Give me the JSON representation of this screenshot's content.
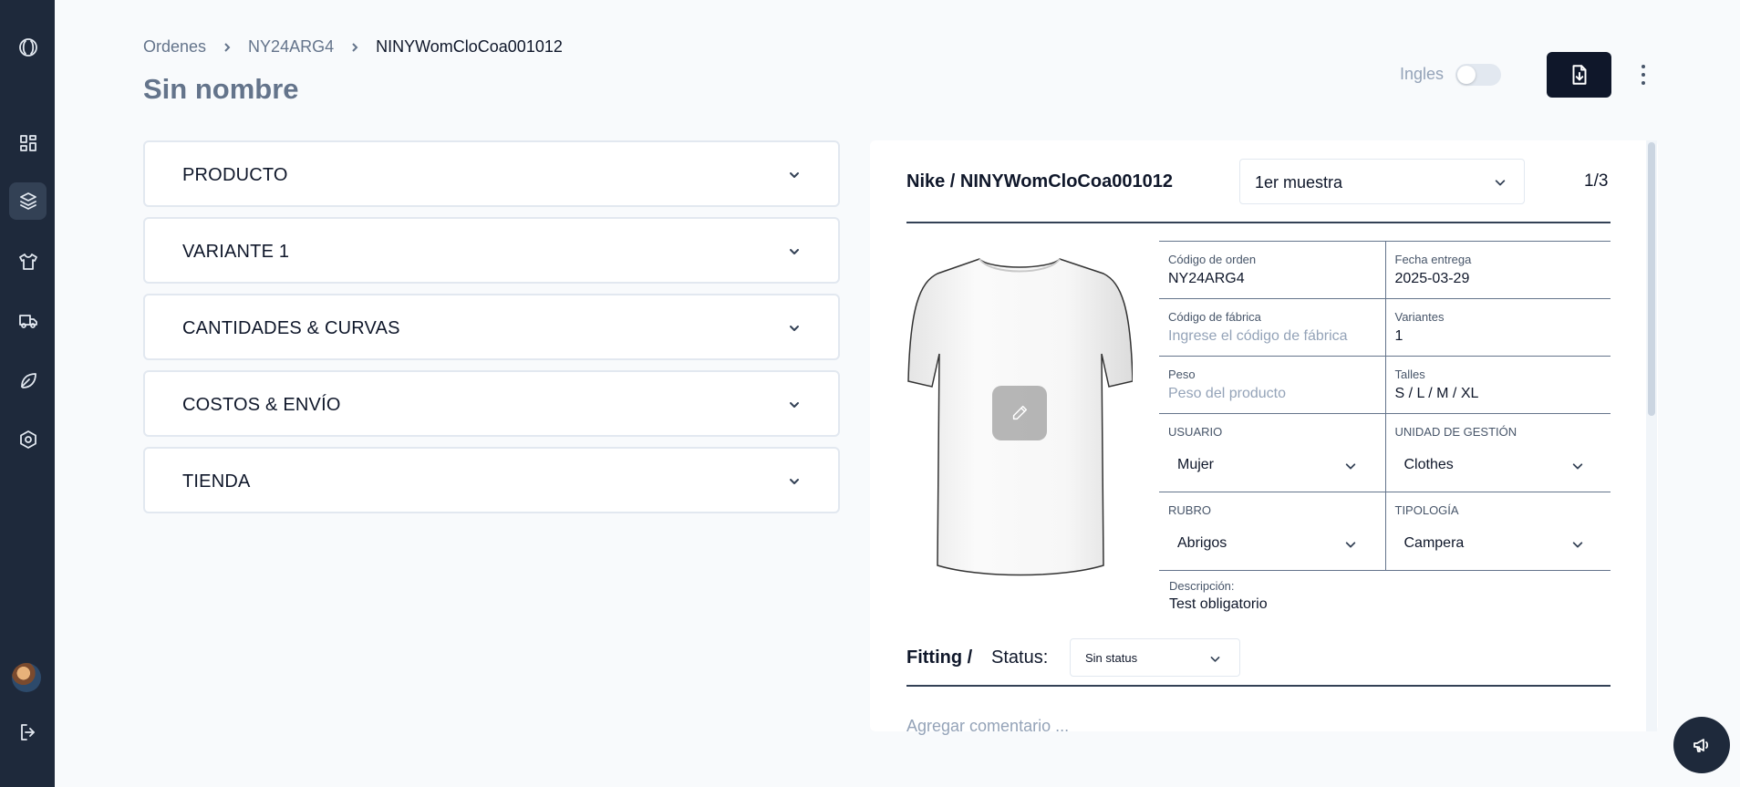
{
  "sidebar": {
    "items": [
      {
        "icon": "logo-icon"
      },
      {
        "icon": "dashboard-icon"
      },
      {
        "icon": "box-icon",
        "active": true
      },
      {
        "icon": "shirt-icon"
      },
      {
        "icon": "truck-icon"
      },
      {
        "icon": "leaf-icon"
      },
      {
        "icon": "settings-icon"
      }
    ],
    "bottom": [
      {
        "icon": "avatar"
      },
      {
        "icon": "logout-icon"
      }
    ]
  },
  "breadcrumb": [
    "Ordenes",
    "NY24ARG4",
    "NINYWomCloCoa001012"
  ],
  "page_title": "Sin nombre",
  "header": {
    "lang_label": "Ingles",
    "lang_toggle_on": false
  },
  "sections": [
    "PRODUCTO",
    "VARIANTE 1",
    "CANTIDADES & CURVAS",
    "COSTOS & ENVÍO",
    "TIENDA"
  ],
  "panel": {
    "title": "Nike / NINYWomCloCoa001012",
    "sample_select": "1er muestra",
    "pager": "1/3",
    "fields": {
      "codigo_orden": {
        "label": "Código de orden",
        "value": "NY24ARG4"
      },
      "fecha_entrega": {
        "label": "Fecha entrega",
        "value": "2025-03-29"
      },
      "codigo_fabrica": {
        "label": "Código de fábrica",
        "placeholder": "Ingrese el código de fábrica"
      },
      "variantes": {
        "label": "Variantes",
        "value": "1"
      },
      "peso": {
        "label": "Peso",
        "placeholder": "Peso del producto"
      },
      "talles": {
        "label": "Talles",
        "value": "S / L / M / XL"
      },
      "usuario": {
        "label": "USUARIO",
        "value": "Mujer"
      },
      "unidad_gestion": {
        "label": "UNIDAD DE GESTIÓN",
        "value": "Clothes"
      },
      "rubro": {
        "label": "RUBRO",
        "value": "Abrigos"
      },
      "tipologia": {
        "label": "TIPOLOGÍA",
        "value": "Campera"
      }
    },
    "description": {
      "label": "Descripción:",
      "value": "Test obligatorio"
    },
    "fitting": {
      "title": "Fitting /",
      "status_label": "Status:",
      "status_value": "Sin status",
      "comment_placeholder": "Agregar comentario ..."
    }
  }
}
